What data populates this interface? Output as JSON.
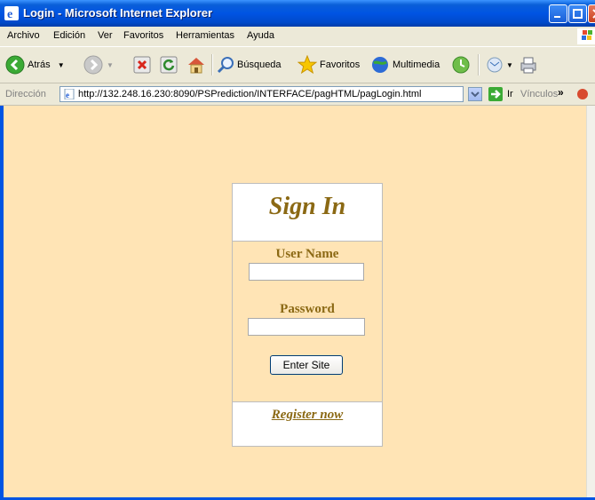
{
  "window": {
    "title": "Login - Microsoft Internet Explorer",
    "controls": {
      "minimize": "minimize-icon",
      "maximize": "maximize-icon",
      "close": "close-icon"
    }
  },
  "menu": [
    "Archivo",
    "Edición",
    "Ver",
    "Favoritos",
    "Herramientas",
    "Ayuda"
  ],
  "toolbar": {
    "back": "Atrás",
    "search": "Búsqueda",
    "favorites": "Favoritos",
    "multimedia": "Multimedia"
  },
  "address": {
    "label": "Dirección",
    "url": "http://132.248.16.230:8090/PSPrediction/INTERFACE/pagHTML/pagLogin.html",
    "go": "Ir",
    "links": "Vínculos",
    "chevron": "»"
  },
  "login": {
    "heading": "Sign In",
    "username_label": "User Name",
    "username_value": "",
    "password_label": "Password",
    "password_value": "",
    "submit": "Enter Site",
    "register": "Register now"
  },
  "colors": {
    "page_bg": "#FFE4B5",
    "accent_text": "#8B6914",
    "titlebar": "#0054E3"
  }
}
